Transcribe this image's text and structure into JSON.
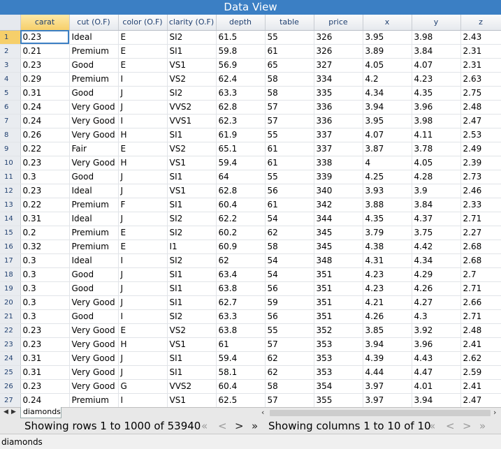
{
  "window": {
    "title": "Data View"
  },
  "columns": [
    "carat",
    "cut (O.F)",
    "color (O.F)",
    "clarity (O.F)",
    "depth",
    "table",
    "price",
    "x",
    "y",
    "z"
  ],
  "rows": [
    [
      "1",
      "0.23",
      "Ideal",
      "E",
      "SI2",
      "61.5",
      "55",
      "326",
      "3.95",
      "3.98",
      "2.43"
    ],
    [
      "2",
      "0.21",
      "Premium",
      "E",
      "SI1",
      "59.8",
      "61",
      "326",
      "3.89",
      "3.84",
      "2.31"
    ],
    [
      "3",
      "0.23",
      "Good",
      "E",
      "VS1",
      "56.9",
      "65",
      "327",
      "4.05",
      "4.07",
      "2.31"
    ],
    [
      "4",
      "0.29",
      "Premium",
      "I",
      "VS2",
      "62.4",
      "58",
      "334",
      "4.2",
      "4.23",
      "2.63"
    ],
    [
      "5",
      "0.31",
      "Good",
      "J",
      "SI2",
      "63.3",
      "58",
      "335",
      "4.34",
      "4.35",
      "2.75"
    ],
    [
      "6",
      "0.24",
      "Very Good",
      "J",
      "VVS2",
      "62.8",
      "57",
      "336",
      "3.94",
      "3.96",
      "2.48"
    ],
    [
      "7",
      "0.24",
      "Very Good",
      "I",
      "VVS1",
      "62.3",
      "57",
      "336",
      "3.95",
      "3.98",
      "2.47"
    ],
    [
      "8",
      "0.26",
      "Very Good",
      "H",
      "SI1",
      "61.9",
      "55",
      "337",
      "4.07",
      "4.11",
      "2.53"
    ],
    [
      "9",
      "0.22",
      "Fair",
      "E",
      "VS2",
      "65.1",
      "61",
      "337",
      "3.87",
      "3.78",
      "2.49"
    ],
    [
      "10",
      "0.23",
      "Very Good",
      "H",
      "VS1",
      "59.4",
      "61",
      "338",
      "4",
      "4.05",
      "2.39"
    ],
    [
      "11",
      "0.3",
      "Good",
      "J",
      "SI1",
      "64",
      "55",
      "339",
      "4.25",
      "4.28",
      "2.73"
    ],
    [
      "12",
      "0.23",
      "Ideal",
      "J",
      "VS1",
      "62.8",
      "56",
      "340",
      "3.93",
      "3.9",
      "2.46"
    ],
    [
      "13",
      "0.22",
      "Premium",
      "F",
      "SI1",
      "60.4",
      "61",
      "342",
      "3.88",
      "3.84",
      "2.33"
    ],
    [
      "14",
      "0.31",
      "Ideal",
      "J",
      "SI2",
      "62.2",
      "54",
      "344",
      "4.35",
      "4.37",
      "2.71"
    ],
    [
      "15",
      "0.2",
      "Premium",
      "E",
      "SI2",
      "60.2",
      "62",
      "345",
      "3.79",
      "3.75",
      "2.27"
    ],
    [
      "16",
      "0.32",
      "Premium",
      "E",
      "I1",
      "60.9",
      "58",
      "345",
      "4.38",
      "4.42",
      "2.68"
    ],
    [
      "17",
      "0.3",
      "Ideal",
      "I",
      "SI2",
      "62",
      "54",
      "348",
      "4.31",
      "4.34",
      "2.68"
    ],
    [
      "18",
      "0.3",
      "Good",
      "J",
      "SI1",
      "63.4",
      "54",
      "351",
      "4.23",
      "4.29",
      "2.7"
    ],
    [
      "19",
      "0.3",
      "Good",
      "J",
      "SI1",
      "63.8",
      "56",
      "351",
      "4.23",
      "4.26",
      "2.71"
    ],
    [
      "20",
      "0.3",
      "Very Good",
      "J",
      "SI1",
      "62.7",
      "59",
      "351",
      "4.21",
      "4.27",
      "2.66"
    ],
    [
      "21",
      "0.3",
      "Good",
      "I",
      "SI2",
      "63.3",
      "56",
      "351",
      "4.26",
      "4.3",
      "2.71"
    ],
    [
      "22",
      "0.23",
      "Very Good",
      "E",
      "VS2",
      "63.8",
      "55",
      "352",
      "3.85",
      "3.92",
      "2.48"
    ],
    [
      "23",
      "0.23",
      "Very Good",
      "H",
      "VS1",
      "61",
      "57",
      "353",
      "3.94",
      "3.96",
      "2.41"
    ],
    [
      "24",
      "0.31",
      "Very Good",
      "J",
      "SI1",
      "59.4",
      "62",
      "353",
      "4.39",
      "4.43",
      "2.62"
    ],
    [
      "25",
      "0.31",
      "Very Good",
      "J",
      "SI1",
      "58.1",
      "62",
      "353",
      "4.44",
      "4.47",
      "2.59"
    ],
    [
      "26",
      "0.23",
      "Very Good",
      "G",
      "VVS2",
      "60.4",
      "58",
      "354",
      "3.97",
      "4.01",
      "2.41"
    ],
    [
      "27",
      "0.24",
      "Premium",
      "I",
      "VS1",
      "62.5",
      "57",
      "355",
      "3.97",
      "3.94",
      "2.47"
    ]
  ],
  "sheet_tab": "diamonds",
  "nav": {
    "rows_text": "Showing rows 1 to 1000 of 53940",
    "cols_text": "Showing columns 1 to 10 of 10",
    "first": "«",
    "prev": "<",
    "next": ">",
    "last": "»"
  },
  "status": {
    "text": "diamonds"
  },
  "colors": {
    "title_bar": "#3b7fc4",
    "selected_header": "#f6cf6a"
  }
}
